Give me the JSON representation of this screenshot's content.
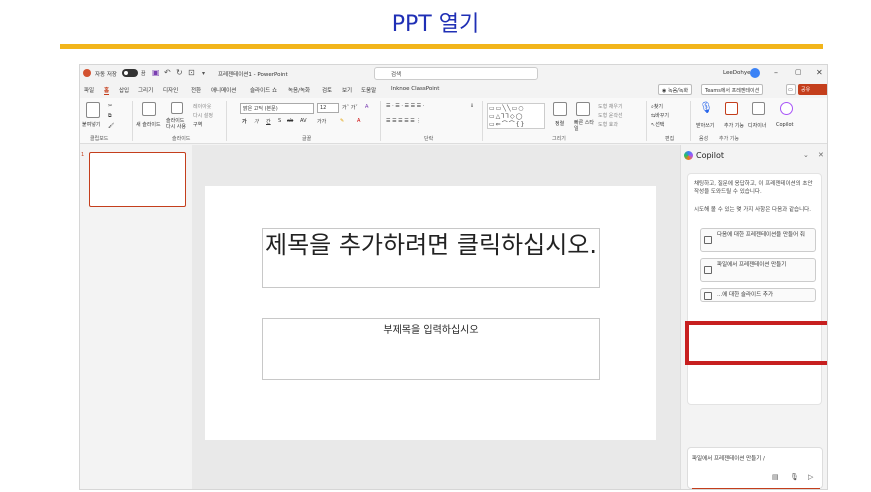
{
  "page": {
    "heading": "PPT 열기",
    "accent_color": "#f2b51b",
    "heading_color": "#1f2fb5"
  },
  "titlebar": {
    "autosave_label": "자동 저장",
    "toggle_state": "끔",
    "doc_title": "프레젠테이션1 - PowerPoint",
    "search_placeholder": "검색",
    "user_name": "LeeDohye",
    "icons": [
      "powerpoint-logo-icon",
      "save-icon",
      "undo-icon",
      "redo-icon",
      "present-icon",
      "search-icon",
      "minimize-icon",
      "restore-icon",
      "close-icon"
    ]
  },
  "menu": {
    "tabs": [
      "파일",
      "홈",
      "삽입",
      "그리기",
      "디자인",
      "전환",
      "애니메이션",
      "슬라이드 쇼",
      "녹음/녹화",
      "검토",
      "보기",
      "도움말",
      "Inknoe ClassPoint"
    ],
    "active_tab": "홈",
    "record_button": "녹음/녹화",
    "teams_button": "Teams에서 프레젠테이션",
    "share_button": "공유"
  },
  "ribbon": {
    "paste": "붙여넣기",
    "new_slide": "새 슬라이드",
    "reuse_slide": "슬라이드 다시 사용",
    "layout": "레이아웃",
    "reset": "다시 설정",
    "section": "구역",
    "font_name": "맑은 고딕 (본문)",
    "font_size": "12",
    "arrange": "정렬",
    "quick_styles": "빠른 스타일",
    "shape_fill": "도형 채우기",
    "shape_outline": "도형 윤곽선",
    "shape_effects": "도형 효과",
    "find": "찾기",
    "replace": "바꾸기",
    "select": "선택",
    "dictate": "받아쓰기",
    "addins": "추가 기능",
    "designer": "디자이너",
    "copilot": "Copilot",
    "groups": [
      "클립보드",
      "슬라이드",
      "글꼴",
      "단락",
      "그리기",
      "편집",
      "음성",
      "추가 기능"
    ]
  },
  "thumbnails": {
    "slide_number": "1"
  },
  "slide": {
    "title_placeholder": "제목을 추가하려면 클릭하십시오.",
    "subtitle_placeholder": "부제목을 입력하십시오"
  },
  "copilot": {
    "title": "Copilot",
    "intro": "채팅하고, 질문에 응답하고, 이 프레젠테이션의 초안 작성을 도와드릴 수 있습니다.",
    "prompt": "시도해 볼 수 있는 몇 가지 사항은 다음과 같습니다.",
    "suggestions": [
      "다음에 대한 프레젠테이션을 만들어 줘",
      "파일에서 프레젠테이션 만들기",
      "...에 대한 슬라이드 추가"
    ],
    "input_text": "파일에서 프레젠테이션 만들기 /",
    "highlight_color": "#c71f1f"
  }
}
